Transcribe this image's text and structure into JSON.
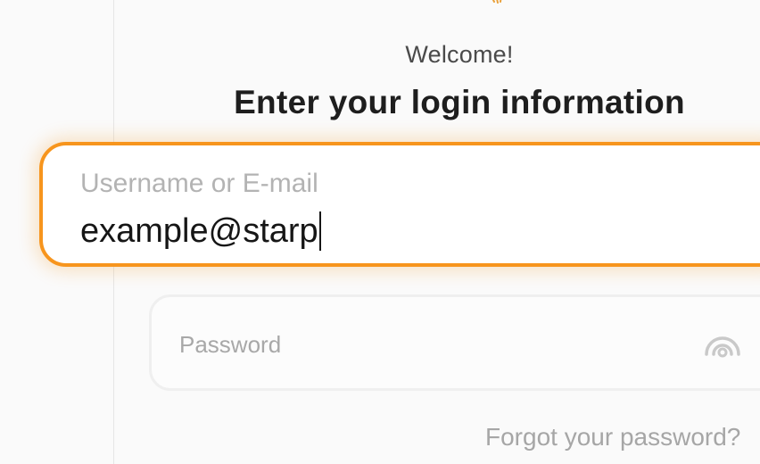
{
  "login": {
    "welcome": "Welcome!",
    "title": "Enter your login information",
    "username": {
      "label": "Username or E-mail",
      "value": "example@starp"
    },
    "password": {
      "placeholder": "Password",
      "toggle_icon": "eye-icon"
    },
    "forgot_password": "Forgot your password?"
  },
  "colors": {
    "accent": "#f7951d",
    "background": "#fafafa",
    "text": "#1e1e1e",
    "muted": "#a8a8a8"
  }
}
